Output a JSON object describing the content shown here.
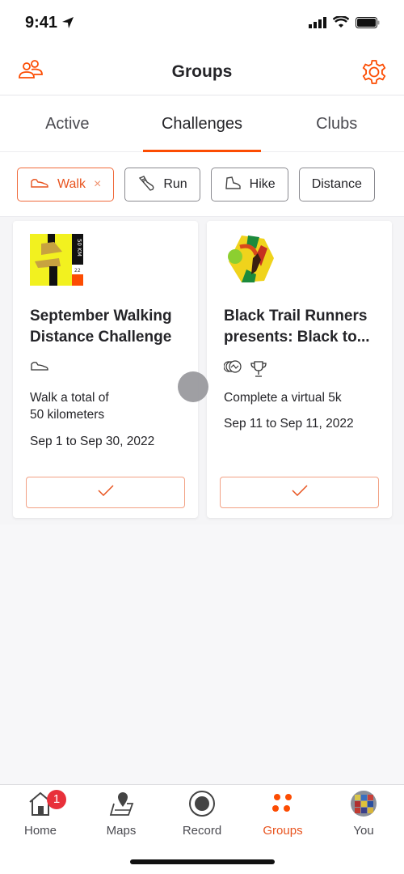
{
  "status_bar": {
    "time": "9:41"
  },
  "header": {
    "title": "Groups",
    "left_icon": "people-icon",
    "right_icon": "gear-icon"
  },
  "tabs": [
    {
      "label": "Active",
      "active": false
    },
    {
      "label": "Challenges",
      "active": true
    },
    {
      "label": "Clubs",
      "active": false
    }
  ],
  "filters": [
    {
      "label": "Walk",
      "icon": "walk-shoe-icon",
      "active": true,
      "removable": true,
      "remove_glyph": "×"
    },
    {
      "label": "Run",
      "icon": "run-shoe-icon",
      "active": false
    },
    {
      "label": "Hike",
      "icon": "hike-boot-icon",
      "active": false
    },
    {
      "label": "Distance",
      "active": false
    }
  ],
  "cards": [
    {
      "title": "September Walking Distance Challenge",
      "badge_text": "50 KM",
      "badge_sub": "22",
      "sport_icons": [
        "walk-shoe-icon"
      ],
      "description": "Walk a total of\n50 kilometers",
      "dates": "Sep 1 to Sep 30, 2022",
      "joined": true
    },
    {
      "title": "Black Trail Runners presents: Black to...",
      "sport_icons": [
        "virtual-run-icon",
        "trophy-icon"
      ],
      "description": "Complete a virtual 5k",
      "dates": "Sep 11 to Sep 11, 2022",
      "joined": true
    }
  ],
  "tabbar": {
    "items": [
      {
        "label": "Home",
        "icon": "home-icon",
        "badge": "1",
        "active": false
      },
      {
        "label": "Maps",
        "icon": "map-icon",
        "active": false
      },
      {
        "label": "Record",
        "icon": "record-icon",
        "active": false
      },
      {
        "label": "Groups",
        "icon": "groups-icon",
        "active": true
      },
      {
        "label": "You",
        "icon": "avatar",
        "active": false
      }
    ]
  },
  "colors": {
    "accent": "#fc4c02",
    "text": "#242428",
    "badge": "#e8303a"
  }
}
